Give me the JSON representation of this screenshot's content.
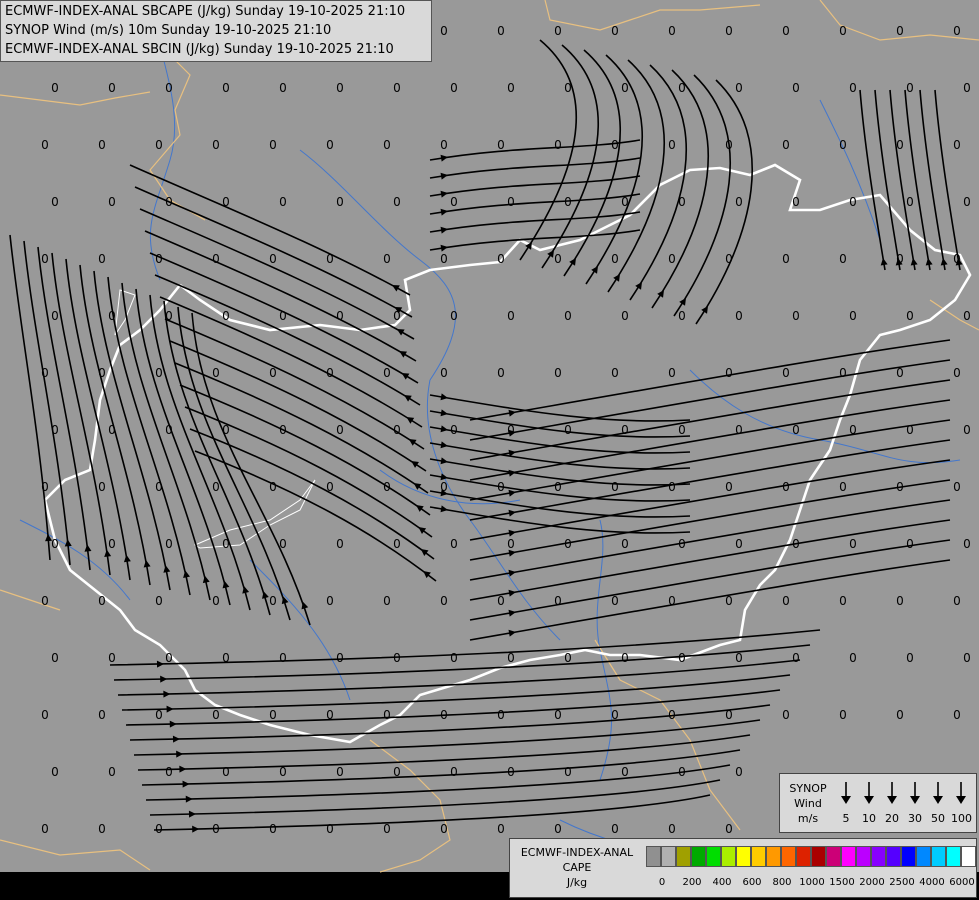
{
  "header": {
    "line1": "ECMWF-INDEX-ANAL SBCAPE (J/kg) Sunday 19-10-2025 21:10",
    "line2": "SYNOP Wind (m/s) 10m Sunday 19-10-2025 21:10",
    "line3": "ECMWF-INDEX-ANAL SBCIN (J/kg) Sunday 19-10-2025 21:10"
  },
  "colors": {
    "background": "#999999",
    "border": "#e8c080",
    "country_border": "#ffffff",
    "river": "#4477cc",
    "streamline": "#000000"
  },
  "map_value_label": "0",
  "wind_legend": {
    "title_lines": [
      "SYNOP",
      "Wind",
      "m/s"
    ],
    "speeds": [
      "5",
      "10",
      "20",
      "30",
      "50",
      "100"
    ]
  },
  "cape_legend": {
    "title_lines": [
      "ECMWF-INDEX-ANAL",
      "CAPE",
      "J/kg"
    ],
    "colors": [
      "#909090",
      "#b0b0b0",
      "#a0a000",
      "#00aa00",
      "#00dd00",
      "#aaee00",
      "#ffff00",
      "#ffcc00",
      "#ff9900",
      "#ff6600",
      "#dd2200",
      "#aa0000",
      "#cc0077",
      "#ff00ff",
      "#bb00ff",
      "#8800ff",
      "#5500ff",
      "#0000ff",
      "#0088ff",
      "#00ccff",
      "#00ffff",
      "#ffffff"
    ],
    "ticks": [
      "0",
      "200",
      "400",
      "600",
      "800",
      "1000",
      "1500",
      "2000",
      "2500",
      "4000",
      "6000"
    ]
  }
}
